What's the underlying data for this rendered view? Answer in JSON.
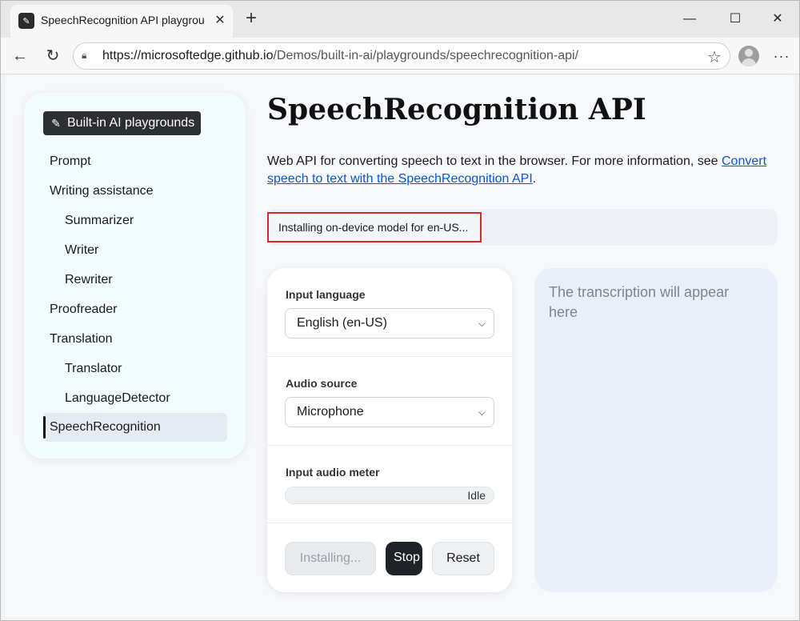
{
  "browser": {
    "tab_title": "SpeechRecognition API playground",
    "new_tab_symbol": "+",
    "url_scheme": "https://",
    "url_domain": "microsoftedge.github.io",
    "url_path": "/Demos/built-in-ai/playgrounds/speechrecognition-api/"
  },
  "sidebar": {
    "brand": "Built-in AI playgrounds",
    "items": [
      {
        "label": "Prompt"
      },
      {
        "label": "Writing assistance"
      },
      {
        "label": "Summarizer"
      },
      {
        "label": "Writer"
      },
      {
        "label": "Rewriter"
      },
      {
        "label": "Proofreader"
      },
      {
        "label": "Translation"
      },
      {
        "label": "Translator"
      },
      {
        "label": "LanguageDetector"
      },
      {
        "label": "SpeechRecognition"
      }
    ]
  },
  "main": {
    "title": "SpeechRecognition API",
    "description": "Web API for converting speech to text in the browser. For more information, see ",
    "description_link": "Convert speech to text with the SpeechRecognition API",
    "description_end": ".",
    "status": "Installing on-device model for en-US..."
  },
  "form": {
    "input_language_label": "Input language",
    "input_language_value": "English (en-US)",
    "audio_source_label": "Audio source",
    "audio_source_value": "Microphone",
    "meter_label": "Input audio meter",
    "meter_status": "Idle",
    "meter_level": 0,
    "install_button": "Installing...",
    "stop_button": "Stop",
    "reset_button": "Reset"
  },
  "transcript": {
    "placeholder": "The transcription will appear here"
  },
  "icons": {
    "favicon": "tools-icon",
    "brand": "tools-icon",
    "back": "arrow-left-icon",
    "refresh": "refresh-icon",
    "lock": "lock-icon",
    "favorite": "star-icon",
    "profile": "avatar-icon",
    "more": "more-icon"
  }
}
